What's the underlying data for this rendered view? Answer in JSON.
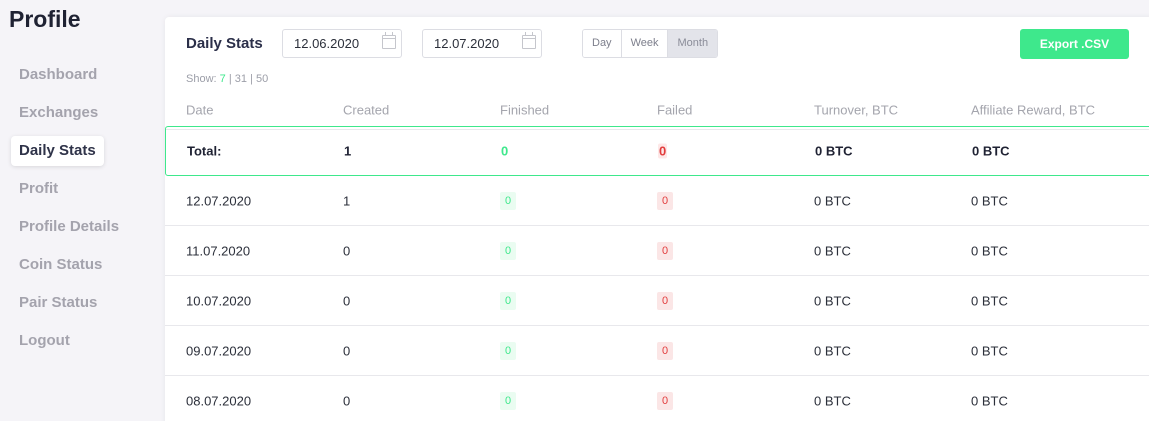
{
  "header": {
    "title": "Profile"
  },
  "sidebar": {
    "items": [
      {
        "label": "Dashboard",
        "active": false
      },
      {
        "label": "Exchanges",
        "active": false
      },
      {
        "label": "Daily Stats",
        "active": true
      },
      {
        "label": "Profit",
        "active": false
      },
      {
        "label": "Profile Details",
        "active": false
      },
      {
        "label": "Coin Status",
        "active": false
      },
      {
        "label": "Pair Status",
        "active": false
      },
      {
        "label": "Logout",
        "active": false
      }
    ]
  },
  "stats": {
    "title": "Daily Stats",
    "date_from": "12.06.2020",
    "date_to": "12.07.2020",
    "periods": [
      "Day",
      "Week",
      "Month"
    ],
    "active_period": "Month",
    "export_label": "Export .CSV",
    "show_label": "Show:",
    "show_options": [
      "7",
      "31",
      "50"
    ],
    "show_active": "7",
    "columns": [
      "Date",
      "Created",
      "Finished",
      "Failed",
      "Turnover, BTC",
      "Affiliate Reward, BTC"
    ],
    "total": {
      "label": "Total:",
      "created": "1",
      "finished": "0",
      "failed": "0",
      "turnover": "0 BTC",
      "reward": "0 BTC"
    },
    "rows": [
      {
        "date": "12.07.2020",
        "created": "1",
        "finished": "0",
        "failed": "0",
        "turnover": "0 BTC",
        "reward": "0 BTC"
      },
      {
        "date": "11.07.2020",
        "created": "0",
        "finished": "0",
        "failed": "0",
        "turnover": "0 BTC",
        "reward": "0 BTC"
      },
      {
        "date": "10.07.2020",
        "created": "0",
        "finished": "0",
        "failed": "0",
        "turnover": "0 BTC",
        "reward": "0 BTC"
      },
      {
        "date": "09.07.2020",
        "created": "0",
        "finished": "0",
        "failed": "0",
        "turnover": "0 BTC",
        "reward": "0 BTC"
      },
      {
        "date": "08.07.2020",
        "created": "0",
        "finished": "0",
        "failed": "0",
        "turnover": "0 BTC",
        "reward": "0 BTC"
      }
    ]
  },
  "colors": {
    "accent": "#3ee88c",
    "danger": "#e23c3c"
  }
}
